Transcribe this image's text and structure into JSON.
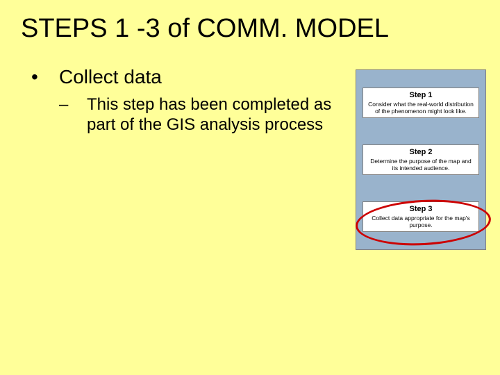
{
  "title": "STEPS 1 -3 of COMM. MODEL",
  "bullet": {
    "symbol": "•",
    "text": "Collect data"
  },
  "sub": {
    "dash": "–",
    "text": "This step has been completed as part of the GIS analysis process"
  },
  "steps": {
    "s1": {
      "title": "Step 1",
      "desc": "Consider what the real-world distribution of the phenomenon might look like."
    },
    "s2": {
      "title": "Step 2",
      "desc": "Determine the purpose of the map and its intended audience."
    },
    "s3": {
      "title": "Step 3",
      "desc": "Collect data appropriate for the map's purpose."
    }
  }
}
